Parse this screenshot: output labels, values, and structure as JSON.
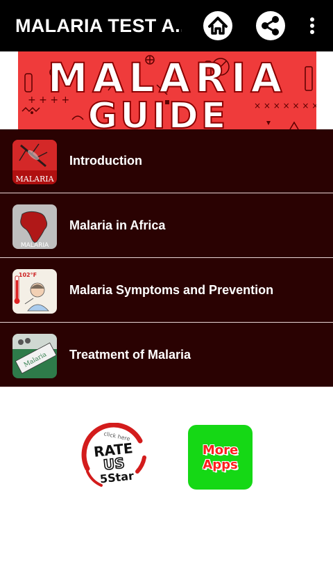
{
  "appbar": {
    "title": "MALARIA TEST A...",
    "home_icon": "home-icon",
    "share_icon": "share-icon",
    "menu_icon": "more-vert-icon"
  },
  "banner": {
    "line1": "MALARIA",
    "line2": "GUIDE",
    "crosses": "× × × × × × ×",
    "pluses": "+ + + +"
  },
  "menu_items": [
    {
      "label": "Introduction",
      "thumb_caption": "MALARIA"
    },
    {
      "label": "Malaria in Africa",
      "thumb_caption": "MALARIA"
    },
    {
      "label": "Malaria Symptoms and Prevention",
      "thumb_caption": "102°F"
    },
    {
      "label": "Treatment of Malaria",
      "thumb_caption": "Malaria"
    }
  ],
  "rate": {
    "click": "click here",
    "rate": "RATE",
    "us": "US",
    "star": "5Star"
  },
  "more_apps": {
    "line1": "More",
    "line2": "Apps"
  },
  "colors": {
    "appbar_bg": "#000000",
    "list_bg": "#2a0202",
    "banner_bg": "#ef3b3b",
    "more_apps_bg": "#15d815",
    "rate_red": "#d31c1c"
  }
}
